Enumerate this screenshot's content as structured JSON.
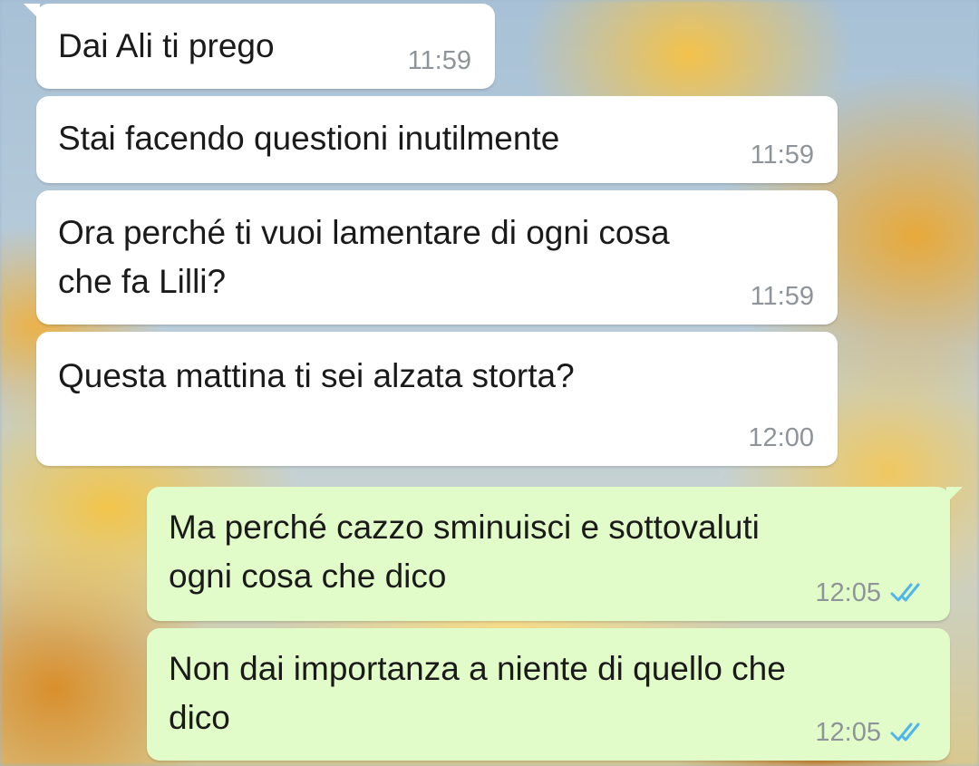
{
  "conversation": {
    "messages": [
      {
        "direction": "incoming",
        "text": "Dai Ali ti prego",
        "time": "11:59"
      },
      {
        "direction": "incoming",
        "text": "Stai facendo questioni inutilmente",
        "time": "11:59"
      },
      {
        "direction": "incoming",
        "text": "Ora perché ti vuoi lamentare di ogni cosa\nche fa Lilli?",
        "time": "11:59"
      },
      {
        "direction": "incoming",
        "text": "Questa mattina ti sei alzata storta?",
        "time": "12:00"
      },
      {
        "direction": "outgoing",
        "text": "Ma perché cazzo sminuisci e sottovaluti\nogni cosa che dico",
        "time": "12:05",
        "status": "read"
      },
      {
        "direction": "outgoing",
        "text": "Non dai importanza a niente di quello che\ndico",
        "time": "12:05",
        "status": "read"
      }
    ]
  },
  "colors": {
    "incoming_bubble": "#ffffff",
    "outgoing_bubble": "#e1fcc8",
    "read_ticks": "#4fb6ec",
    "timestamp": "#8e9499"
  },
  "icons": {
    "read_status": "double-check-icon"
  }
}
